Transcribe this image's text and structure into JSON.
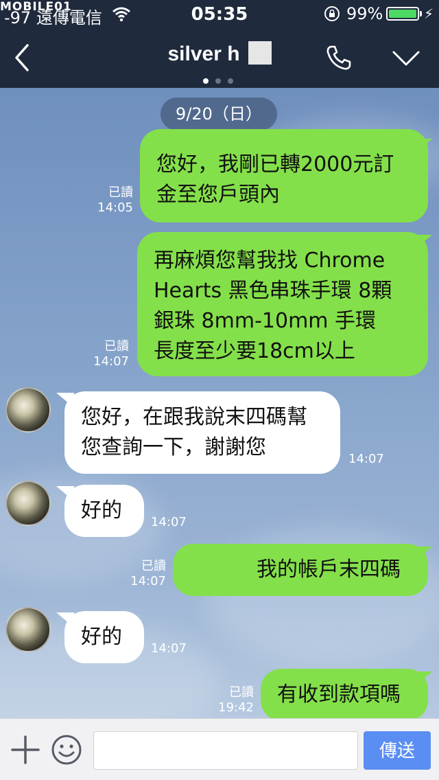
{
  "status_bar": {
    "carrier": "-97 遠傳電信",
    "watermark": "MOBILE01",
    "time": "05:35",
    "battery_percent": "99%",
    "battery_level": 0.99,
    "battery_color": "#4cd964"
  },
  "header": {
    "title": "silver h",
    "back_icon": "chevron-left-icon",
    "call_icon": "phone-icon",
    "menu_icon": "chevron-down-icon",
    "page_dots": 3,
    "active_dot": 0
  },
  "chat": {
    "date_label": "9/20（日）",
    "messages": [
      {
        "from": "me",
        "lines": [
          "您好，我剛已轉2000元訂",
          "金至您戶頭內"
        ],
        "read": "已讀",
        "time": "14:05"
      },
      {
        "from": "me",
        "lines": [
          "再麻煩您幫我找  Chrome",
          "Hearts 黑色串珠手環  8顆",
          "銀珠  8mm-10mm  手環",
          "長度至少要18cm以上"
        ],
        "read": "已讀",
        "time": "14:07"
      },
      {
        "from": "them",
        "lines": [
          "您好，在跟我說末四碼幫",
          "您查詢一下，謝謝您"
        ],
        "time": "14:07"
      },
      {
        "from": "them",
        "lines": [
          "好的"
        ],
        "time": "14:07"
      },
      {
        "from": "me",
        "lines": [
          "我的帳戶末四碼"
        ],
        "read": "已讀",
        "time": "14:07"
      },
      {
        "from": "them",
        "lines": [
          "好的"
        ],
        "time": "14:07"
      },
      {
        "from": "me",
        "lines": [
          "有收到款項嗎"
        ],
        "read": "已讀",
        "time": "19:42"
      }
    ],
    "colors": {
      "me_bubble": "#84e04a",
      "them_bubble": "#ffffff"
    }
  },
  "input_bar": {
    "plus_icon": "plus-icon",
    "emoji_icon": "emoji-icon",
    "input_value": "",
    "send_label": "傳送",
    "send_color": "#5b8ef3"
  }
}
